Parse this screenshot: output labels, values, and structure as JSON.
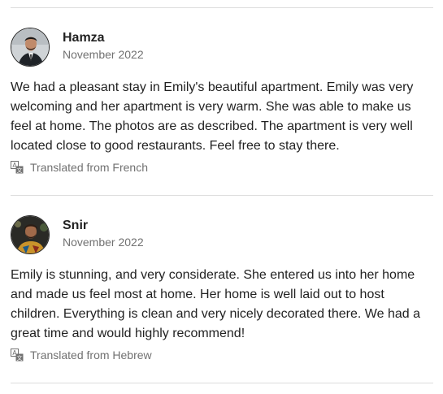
{
  "reviews": [
    {
      "name": "Hamza",
      "date": "November 2022",
      "text": "We had a pleasant stay in Emily's beautiful apartment. Emily was very welcoming and her apartment is very warm. She was able to make us feel at home. The photos are as described. The apartment is very well located close to good restaurants. Feel free to stay there.",
      "translated": "Translated from French",
      "translate_icon": "translate-icon"
    },
    {
      "name": "Snir",
      "date": "November 2022",
      "text": "Emily is stunning, and very considerate. She entered us into her home and made us feel most at home. Her home is well laid out to host children. Everything is clean and very nicely decorated there. We had a great time and would highly recommend!",
      "translated": "Translated from Hebrew",
      "translate_icon": "translate-icon"
    }
  ],
  "colors": {
    "text": "#222222",
    "muted": "#717171",
    "divider": "#dddddd"
  }
}
